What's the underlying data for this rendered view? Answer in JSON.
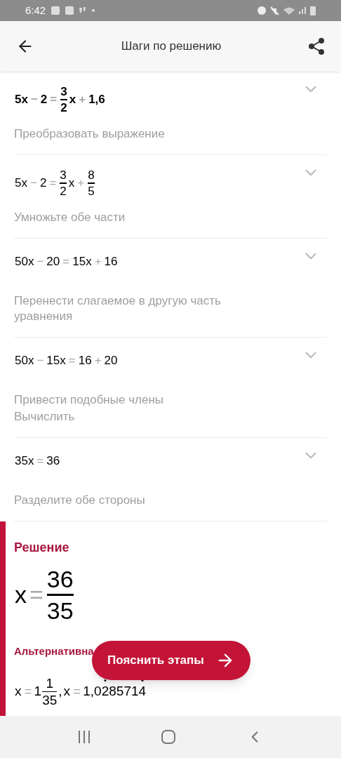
{
  "status_bar": {
    "time": "6:42"
  },
  "header": {
    "title": "Шаги по решению"
  },
  "steps": [
    {
      "bold": true,
      "expanded": false,
      "equation": [
        {
          "kind": "text",
          "t": "5x"
        },
        {
          "kind": "op",
          "t": "−"
        },
        {
          "kind": "text",
          "t": "2"
        },
        {
          "kind": "op",
          "t": "="
        },
        {
          "kind": "frac",
          "num": "3",
          "den": "2"
        },
        {
          "kind": "text",
          "t": "x"
        },
        {
          "kind": "op",
          "t": "+"
        },
        {
          "kind": "text",
          "t": "1,6"
        }
      ],
      "description": [
        "Преобразовать выражение"
      ]
    },
    {
      "bold": false,
      "expanded": false,
      "equation": [
        {
          "kind": "text",
          "t": "5x"
        },
        {
          "kind": "op",
          "t": "−"
        },
        {
          "kind": "text",
          "t": "2"
        },
        {
          "kind": "op",
          "t": "="
        },
        {
          "kind": "frac",
          "num": "3",
          "den": "2"
        },
        {
          "kind": "text",
          "t": "x"
        },
        {
          "kind": "op",
          "t": "+"
        },
        {
          "kind": "frac",
          "num": "8",
          "den": "5"
        }
      ],
      "description": [
        "Умножьте обе части"
      ]
    },
    {
      "bold": false,
      "expanded": false,
      "equation": [
        {
          "kind": "text",
          "t": "50x"
        },
        {
          "kind": "op",
          "t": "−"
        },
        {
          "kind": "text",
          "t": "20"
        },
        {
          "kind": "op",
          "t": "="
        },
        {
          "kind": "text",
          "t": "15x"
        },
        {
          "kind": "op",
          "t": "+"
        },
        {
          "kind": "text",
          "t": "16"
        }
      ],
      "description": [
        "Перенести слагаемое в другую часть уравнения"
      ]
    },
    {
      "bold": false,
      "expanded": false,
      "equation": [
        {
          "kind": "text",
          "t": "50x"
        },
        {
          "kind": "op",
          "t": "−"
        },
        {
          "kind": "text",
          "t": "15x"
        },
        {
          "kind": "op",
          "t": "="
        },
        {
          "kind": "text",
          "t": "16"
        },
        {
          "kind": "op",
          "t": "+"
        },
        {
          "kind": "text",
          "t": "20"
        }
      ],
      "description": [
        "Привести подобные члены",
        "Вычислить"
      ]
    },
    {
      "bold": false,
      "expanded": false,
      "equation": [
        {
          "kind": "text",
          "t": "35x"
        },
        {
          "kind": "op",
          "t": "="
        },
        {
          "kind": "text",
          "t": "36"
        }
      ],
      "description": [
        "Разделите обе стороны"
      ]
    }
  ],
  "solution": {
    "title": "Решение",
    "result": [
      {
        "kind": "text",
        "t": "x"
      },
      {
        "kind": "op",
        "t": "="
      },
      {
        "kind": "frac",
        "num": "36",
        "den": "35"
      }
    ],
    "alternative_label": "Альтернативна",
    "alternative": [
      {
        "kind": "text",
        "t": "x"
      },
      {
        "kind": "op",
        "t": "="
      },
      {
        "kind": "mixed",
        "whole": "1",
        "num": "1",
        "den": "35"
      },
      {
        "kind": "text",
        "t": ","
      },
      {
        "kind": "text",
        "t": "x"
      },
      {
        "kind": "op",
        "t": "="
      },
      {
        "kind": "repeating",
        "prefix": "1,0",
        "period": "285714"
      }
    ]
  },
  "action_button": {
    "label": "Пояснить этапы"
  }
}
